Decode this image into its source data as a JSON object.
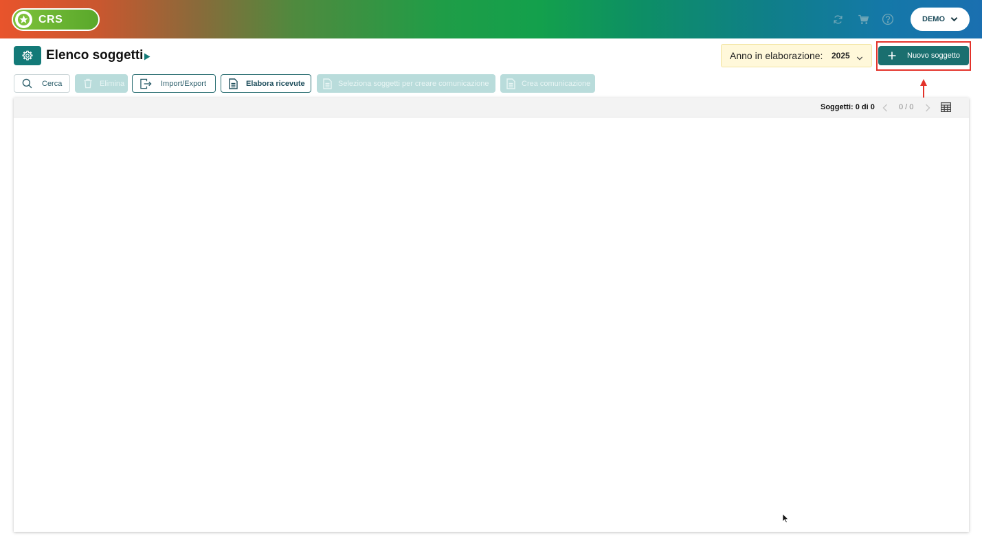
{
  "header": {
    "logo_text": "CRS",
    "icons": [
      "refresh-icon",
      "cart-icon",
      "help-icon"
    ],
    "user_label": "DEMO"
  },
  "page": {
    "title": "Elenco soggetti",
    "anno_label": "Anno in elaborazione:",
    "anno_value": "2025",
    "new_button_label": "Nuovo soggetto"
  },
  "toolbar": {
    "cerca": "Cerca",
    "elimina": "Elimina",
    "import_export": "Import/Export",
    "elabora_ricevute": "Elabora ricevute",
    "seleziona": "Seleziona soggetti per creare comunicazione",
    "crea": "Crea comunicazione"
  },
  "grid": {
    "count_label": "Soggetti: 0 di 0",
    "pager_text": "0 / 0"
  },
  "colors": {
    "primary": "#137a78",
    "disabled": "#b9dcdb",
    "highlight": "#e3322a",
    "anno_bg": "#fff8da"
  }
}
